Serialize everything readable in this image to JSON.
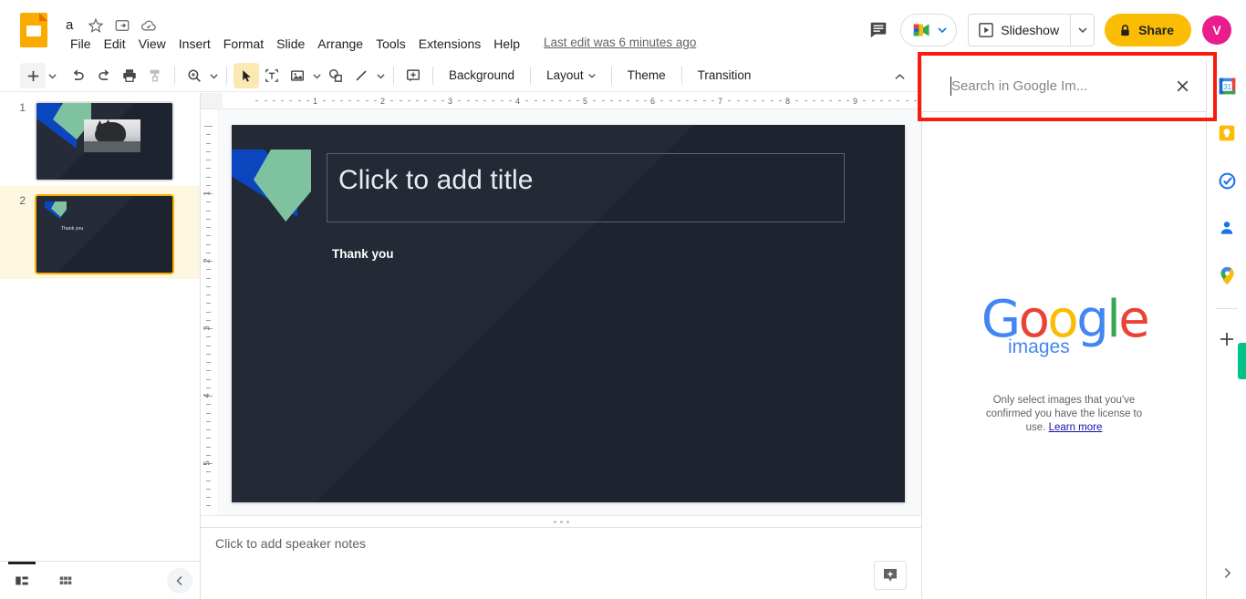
{
  "app": {
    "name": "Google Slides",
    "logo_icon": "slides-logo-icon"
  },
  "document": {
    "title": "a",
    "star_icon": "star-icon",
    "move_icon": "move-to-folder-icon",
    "cloud_icon": "cloud-saved-icon",
    "last_edit": "Last edit was 6 minutes ago"
  },
  "menubar": {
    "items": [
      {
        "label": "File"
      },
      {
        "label": "Edit"
      },
      {
        "label": "View"
      },
      {
        "label": "Insert"
      },
      {
        "label": "Format"
      },
      {
        "label": "Slide"
      },
      {
        "label": "Arrange"
      },
      {
        "label": "Tools"
      },
      {
        "label": "Extensions"
      },
      {
        "label": "Help"
      }
    ]
  },
  "topright": {
    "comment_icon": "comment-history-icon",
    "meet_icon": "google-meet-icon",
    "meet_caret_icon": "chevron-down-icon",
    "slideshow_label": "Slideshow",
    "slideshow_icon": "play-slideshow-icon",
    "slideshow_caret_icon": "chevron-down-icon",
    "share_label": "Share",
    "share_icon": "lock-icon",
    "avatar_initial": "V"
  },
  "toolbar": {
    "new_slide_icon": "plus-icon",
    "new_slide_caret_icon": "chevron-down-icon",
    "undo_icon": "undo-icon",
    "redo_icon": "redo-icon",
    "print_icon": "print-icon",
    "paint_format_icon": "paint-format-icon",
    "zoom_icon": "zoom-icon",
    "zoom_caret_icon": "chevron-down-icon",
    "select_icon": "cursor-select-icon",
    "textbox_icon": "text-box-icon",
    "image_icon": "insert-image-icon",
    "image_caret_icon": "chevron-down-icon",
    "shape_icon": "shape-icon",
    "line_icon": "line-icon",
    "line_caret_icon": "chevron-down-icon",
    "comment_icon": "add-comment-icon",
    "background_label": "Background",
    "layout_label": "Layout",
    "layout_caret_icon": "chevron-down-icon",
    "theme_label": "Theme",
    "transition_label": "Transition",
    "collapse_icon": "chevron-up-icon"
  },
  "filmstrip": {
    "slides": [
      {
        "number": "1",
        "selected": false
      },
      {
        "number": "2",
        "selected": true,
        "text": "Thank you"
      }
    ],
    "bottom": {
      "filmstrip_view_icon": "filmstrip-view-icon",
      "grid_view_icon": "grid-view-icon",
      "collapse_icon": "chevron-left-icon"
    }
  },
  "rulers": {
    "horizontal_numbers": [
      "1",
      "2",
      "3",
      "4",
      "5",
      "6",
      "7",
      "8",
      "9"
    ],
    "vertical_numbers": [
      "1",
      "2",
      "3",
      "4",
      "5"
    ]
  },
  "slide": {
    "title_placeholder": "Click to add title",
    "body_text": "Thank you",
    "background_color": "#1d2430",
    "accent_blue": "#0b46bf",
    "accent_green": "#7fc2a0"
  },
  "notes": {
    "placeholder": "Click to add speaker notes",
    "explore_icon": "explore-icon"
  },
  "image_panel": {
    "search_placeholder": "Search in Google Im...",
    "search_value": "",
    "clear_icon": "close-icon",
    "logo": {
      "letters": [
        "G",
        "o",
        "o",
        "g",
        "l",
        "e"
      ],
      "subtitle": "images"
    },
    "license_text": "Only select images that you've confirmed you have the license to use.",
    "license_link": "Learn more"
  },
  "side_rail": {
    "items": [
      {
        "name": "google-calendar-icon"
      },
      {
        "name": "google-keep-icon"
      },
      {
        "name": "google-tasks-icon"
      },
      {
        "name": "google-contacts-icon"
      },
      {
        "name": "google-maps-icon"
      }
    ],
    "add_icon": "plus-icon",
    "collapse_icon": "chevron-right-icon"
  },
  "highlight": {
    "color": "#f91c0c",
    "target": "search-in-google-images-input"
  }
}
